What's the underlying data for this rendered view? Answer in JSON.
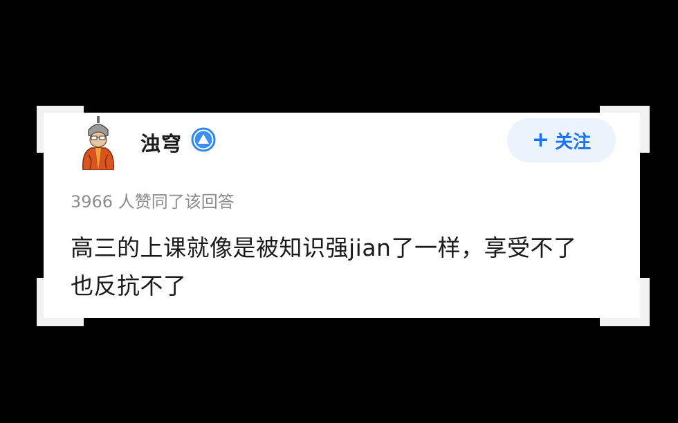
{
  "answer_card": {
    "author": {
      "name": "浊穹",
      "avatar_icon": "cartoon-monk-avatar-icon",
      "badge_icon": "blue-triangle-badge-icon"
    },
    "follow_button": {
      "icon": "plus-icon",
      "plus_glyph": "+",
      "label": "关注"
    },
    "likes_text": "3966 人赞同了该回答",
    "answer_lines": [
      "高三的上课就像是被知识强jian了一样，享受不了",
      "也反抗不了"
    ]
  },
  "colors": {
    "background": "#000000",
    "card": "#ffffff",
    "accent": "#1772f6",
    "follow_bg": "#ebf3fd",
    "muted_text": "#8c8c8c"
  }
}
